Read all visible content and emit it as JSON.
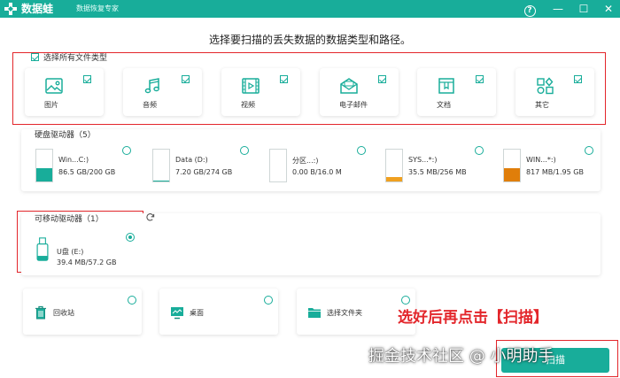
{
  "window": {
    "app_name": "数据蛙",
    "app_subtitle": "数据恢复专家",
    "help_label": "?",
    "minimize_label": "—",
    "maximize_label": "☐",
    "close_label": "✕",
    "accent_color": "#18ad9a"
  },
  "header": {
    "instruction": "选择要扫描的丢失数据的数据类型和路径。"
  },
  "file_types": {
    "select_all_label": "选择所有文件类型",
    "select_all_checked": true,
    "items": [
      {
        "label": "图片",
        "icon": "image-icon",
        "checked": true
      },
      {
        "label": "音频",
        "icon": "music-icon",
        "checked": true
      },
      {
        "label": "视频",
        "icon": "video-icon",
        "checked": true
      },
      {
        "label": "电子邮件",
        "icon": "mail-icon",
        "checked": true
      },
      {
        "label": "文档",
        "icon": "document-icon",
        "checked": true
      },
      {
        "label": "其它",
        "icon": "other-icon",
        "checked": true
      }
    ]
  },
  "hard_drives": {
    "title": "硬盘驱动器（5）",
    "items": [
      {
        "name": "Win...C:)",
        "size": "86.5 GB/200 GB",
        "used_fraction": 0.43,
        "fill_color": "#18ad9a"
      },
      {
        "name": "Data (D:)",
        "size": "7.20 GB/274 GB",
        "used_fraction": 0.03,
        "fill_color": "#18ad9a"
      },
      {
        "name": "分区...:)",
        "size": "0.00  B/16.0 M",
        "used_fraction": 0.0,
        "fill_color": "#f0a020"
      },
      {
        "name": "SYS...*:)",
        "size": "35.5 MB/256 MB",
        "used_fraction": 0.14,
        "fill_color": "#f0a020"
      },
      {
        "name": "WIN...*:)",
        "size": "817 MB/1.95 GB",
        "used_fraction": 0.41,
        "fill_color": "#e07e0a"
      }
    ]
  },
  "removable_drives": {
    "title": "可移动驱动器（1）",
    "refresh_icon": "refresh-icon",
    "items": [
      {
        "name": "U盘 (E:)",
        "size": "39.4 MB/57.2 GB",
        "selected": true
      }
    ]
  },
  "locations": [
    {
      "label": "回收站",
      "icon": "trash-icon"
    },
    {
      "label": "桌面",
      "icon": "desktop-icon"
    },
    {
      "label": "选择文件夹",
      "icon": "folder-icon"
    }
  ],
  "annotation": "选好后再点击【扫描】",
  "watermark": "掘金技术社区 @ 小明助手",
  "scan_button_label": "扫描"
}
